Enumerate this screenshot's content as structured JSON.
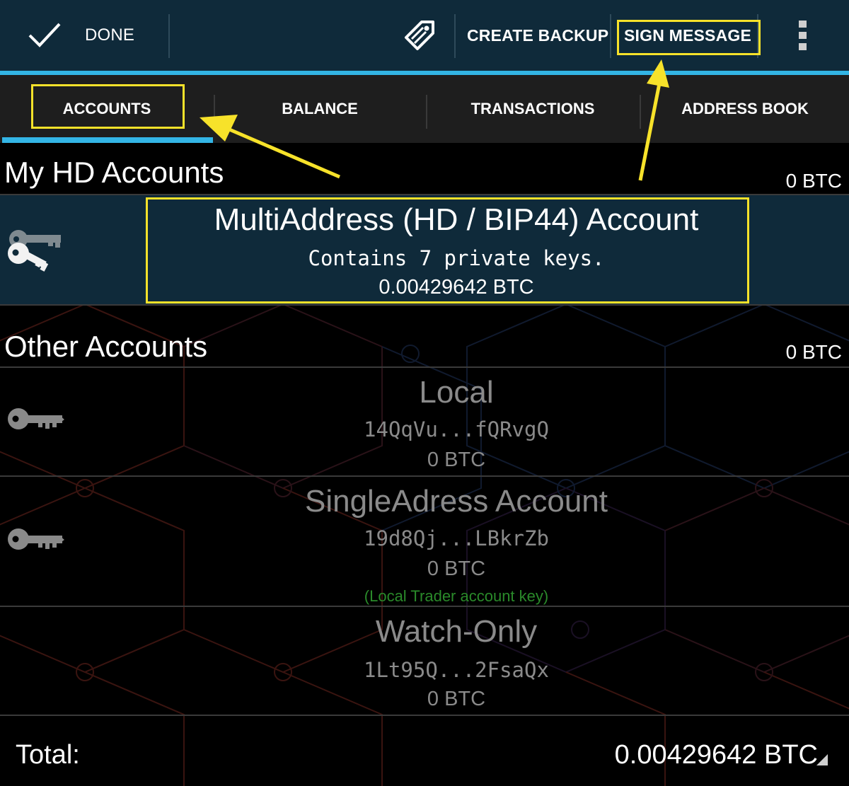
{
  "action_bar": {
    "done_label": "DONE",
    "create_backup_label": "CREATE BACKUP",
    "sign_message_label": "SIGN MESSAGE",
    "icons": [
      "check-icon",
      "tag-icon",
      "overflow-menu-icon"
    ]
  },
  "tabs": [
    {
      "label": "ACCOUNTS",
      "selected": true
    },
    {
      "label": "BALANCE",
      "selected": false
    },
    {
      "label": "TRANSACTIONS",
      "selected": false
    },
    {
      "label": "ADDRESS BOOK",
      "selected": false
    }
  ],
  "hd_section": {
    "title": "My HD Accounts",
    "total": "0 BTC",
    "account": {
      "name": "MultiAddress (HD / BIP44) Account",
      "subtitle": "Contains 7 private keys.",
      "balance": "0.00429642 BTC",
      "icon": "keys-icon"
    }
  },
  "other_section": {
    "title": "Other Accounts",
    "total": "0 BTC",
    "accounts": [
      {
        "name": "Local",
        "address": "14QqVu...fQRvgQ",
        "balance": "0 BTC",
        "icon": "key-icon"
      },
      {
        "name": "SingleAdress Account",
        "address": "19d8Qj...LBkrZb",
        "balance": "0 BTC",
        "note": "(Local Trader account key)",
        "icon": "key-icon"
      },
      {
        "name": "Watch-Only",
        "address": "1Lt95Q...2FsaQx",
        "balance": "0 BTC"
      }
    ]
  },
  "footer": {
    "total_label": "Total:",
    "total_value": "0.00429642 BTC"
  },
  "colors": {
    "action_bar_bg": "#0f2a3a",
    "accent": "#33b5e5",
    "highlight": "#f7e22a",
    "note_green": "#2a8a2a"
  }
}
